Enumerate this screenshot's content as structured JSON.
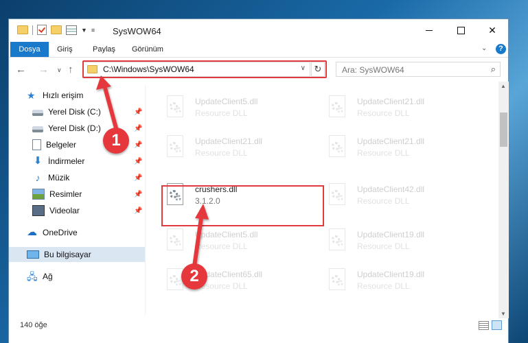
{
  "window": {
    "title": "SysWOW64",
    "controls": {
      "minimize": "minimize",
      "maximize": "maximize",
      "close": "✕"
    }
  },
  "ribbon": {
    "tabs": [
      {
        "label": "Dosya"
      },
      {
        "label": "Giriş"
      },
      {
        "label": "Paylaş"
      },
      {
        "label": "Görünüm"
      }
    ],
    "help": "?"
  },
  "address": {
    "path": "C:\\Windows\\SysWOW64",
    "search_placeholder": "Ara: SysWOW64"
  },
  "navigation": {
    "items": [
      {
        "label": "Hızlı erişim",
        "icon": "star-icon"
      },
      {
        "label": "Yerel Disk (C:)",
        "icon": "drive-icon",
        "pinned": true
      },
      {
        "label": "Yerel Disk (D:)",
        "icon": "drive-icon",
        "pinned": true
      },
      {
        "label": "Belgeler",
        "icon": "documents-icon",
        "pinned": true
      },
      {
        "label": "İndirmeler",
        "icon": "downloads-icon",
        "pinned": true
      },
      {
        "label": "Müzik",
        "icon": "music-icon",
        "pinned": true
      },
      {
        "label": "Resimler",
        "icon": "pictures-icon",
        "pinned": true
      },
      {
        "label": "Videolar",
        "icon": "videos-icon",
        "pinned": true
      },
      {
        "label": "OneDrive",
        "icon": "cloud-icon"
      },
      {
        "label": "Bu bilgisayar",
        "icon": "computer-icon",
        "selected": true
      },
      {
        "label": "Ağ",
        "icon": "network-icon"
      }
    ]
  },
  "files": [
    {
      "name": "UpdateClient5.dll",
      "desc": "Resource DLL",
      "faded": true
    },
    {
      "name": "UpdateClient21.dll",
      "desc": "Resource DLL",
      "faded": true
    },
    {
      "name": "UpdateClient21.dll",
      "desc": "Resource DLL",
      "faded": true
    },
    {
      "name": "UpdateClient21.dll",
      "desc": "Resource DLL",
      "faded": true
    },
    {
      "name": "crushers.dll",
      "desc": "3.1.2.0",
      "faded": false,
      "highlighted": true
    },
    {
      "name": "UpdateClient42.dll",
      "desc": "Resource DLL",
      "faded": true
    },
    {
      "name": "UpdateClient5.dll",
      "desc": "Resource DLL",
      "faded": true
    },
    {
      "name": "UpdateClient19.dll",
      "desc": "Resource DLL",
      "faded": true
    },
    {
      "name": "UpdateClient65.dll",
      "desc": "Resource DLL",
      "faded": true
    },
    {
      "name": "UpdateClient19.dll",
      "desc": "Resource DLL",
      "faded": true
    }
  ],
  "status": {
    "count": "140 öğe"
  },
  "callouts": [
    {
      "label": "1"
    },
    {
      "label": "2"
    }
  ],
  "colors": {
    "accent": "#1979ca",
    "highlight": "#e0393e"
  }
}
